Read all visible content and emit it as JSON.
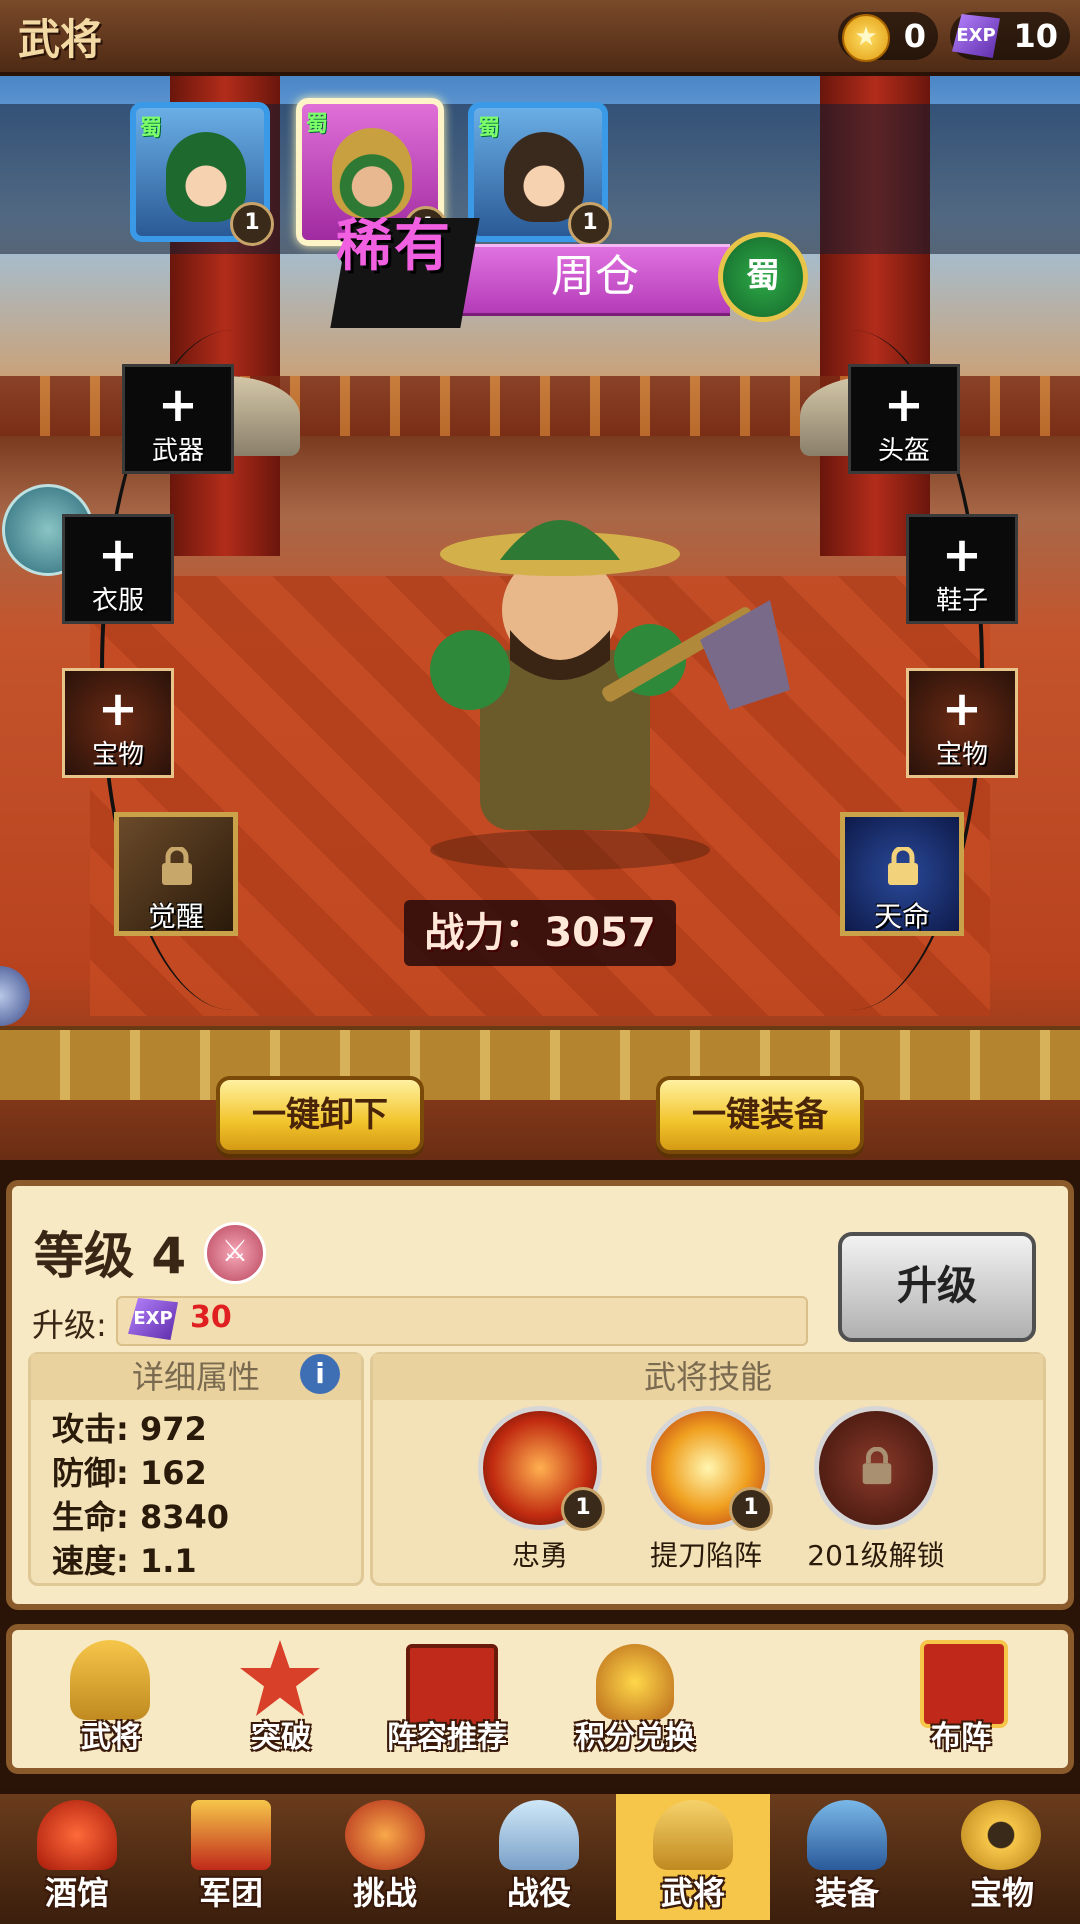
{
  "header": {
    "title": "武将",
    "gold": "0",
    "exp": "10",
    "exp_icon_text": "EXP"
  },
  "roster": [
    {
      "faction": "蜀",
      "level": "1",
      "selected": false
    },
    {
      "faction": "蜀",
      "level": "4",
      "selected": true
    },
    {
      "faction": "蜀",
      "level": "1",
      "selected": false
    }
  ],
  "hero": {
    "rarity": "稀有",
    "name": "周仓",
    "faction": "蜀"
  },
  "equipment": {
    "weapon": "武器",
    "helmet": "头盔",
    "clothes": "衣服",
    "shoes": "鞋子",
    "treasure_left": "宝物",
    "treasure_right": "宝物",
    "awaken": "觉醒",
    "destiny": "天命",
    "plus": "+"
  },
  "power": {
    "text": "战力：3057"
  },
  "actions": {
    "unequip_all": "一键卸下",
    "equip_all": "一键装备"
  },
  "stats": {
    "level_text": "等级 4",
    "upgrade_label": "升级:",
    "upgrade_cost": "30",
    "upgrade_button": "升级",
    "attr_title": "详细属性",
    "skill_title": "武将技能",
    "attrs": [
      {
        "text": "攻击: 972"
      },
      {
        "text": "防御: 162"
      },
      {
        "text": "生命: 8340"
      },
      {
        "text": "速度: 1.1"
      }
    ],
    "skills": [
      {
        "name": "忠勇",
        "level": "1"
      },
      {
        "name": "提刀陷阵",
        "level": "1"
      },
      {
        "name": "201级解锁",
        "level": ""
      }
    ]
  },
  "quick_actions": [
    "武将",
    "突破",
    "阵容推荐",
    "积分兑换",
    "布阵"
  ],
  "nav": [
    "酒馆",
    "军团",
    "挑战",
    "战役",
    "武将",
    "装备",
    "宝物"
  ],
  "nav_active": "武将",
  "colors": {
    "accent_gold": "#f2c42c",
    "rare_purple": "#d65cd6",
    "shu_green": "#2eaa48"
  }
}
